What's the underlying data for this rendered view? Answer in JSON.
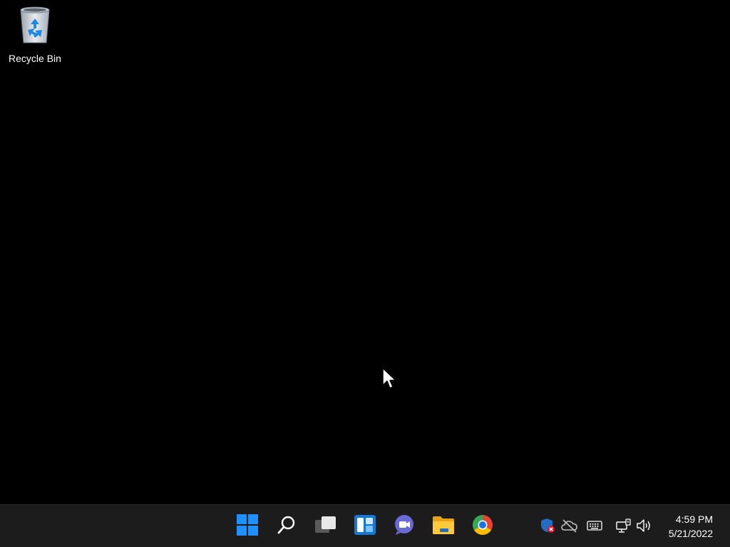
{
  "desktop": {
    "icons": [
      {
        "label": "Recycle Bin",
        "icon": "recycle-bin-icon"
      }
    ]
  },
  "taskbar": {
    "apps": [
      {
        "name": "Start",
        "icon": "windows-start-icon"
      },
      {
        "name": "Search",
        "icon": "search-icon"
      },
      {
        "name": "Task View",
        "icon": "task-view-icon"
      },
      {
        "name": "Widgets",
        "icon": "widgets-icon"
      },
      {
        "name": "Chat",
        "icon": "teams-chat-icon"
      },
      {
        "name": "File Explorer",
        "icon": "file-explorer-icon"
      },
      {
        "name": "Google Chrome",
        "icon": "chrome-icon"
      }
    ],
    "tray": [
      {
        "name": "Windows Security",
        "icon": "security-shield-error-icon"
      },
      {
        "name": "OneDrive",
        "icon": "onedrive-offline-icon"
      },
      {
        "name": "Touch Keyboard",
        "icon": "keyboard-icon"
      },
      {
        "name": "Network",
        "icon": "network-icon"
      },
      {
        "name": "Volume",
        "icon": "volume-icon"
      }
    ],
    "clock": {
      "time": "4:59 PM",
      "date": "5/21/2022"
    }
  },
  "colors": {
    "desktop_background": "#000000",
    "taskbar_background": "#1c1c1c",
    "windows_blue": "#0078d4",
    "folder_yellow": "#ffc83d"
  }
}
